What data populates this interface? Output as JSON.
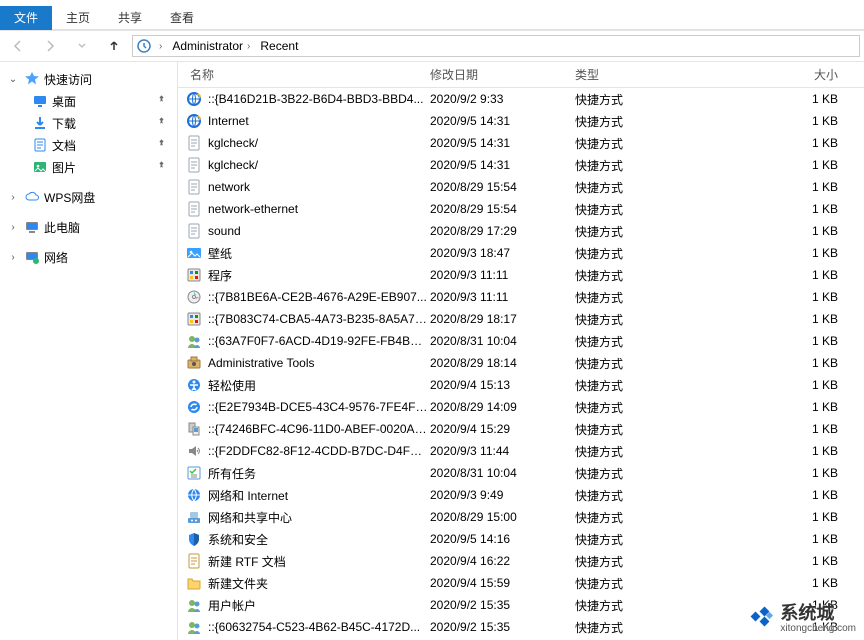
{
  "ribbon": {
    "file": "文件",
    "tabs": [
      "主页",
      "共享",
      "查看"
    ]
  },
  "address": {
    "crumbs": [
      "Administrator",
      "Recent"
    ]
  },
  "nav": {
    "quick": "快速访问",
    "quick_items": [
      {
        "label": "桌面",
        "icon": "desktop"
      },
      {
        "label": "下载",
        "icon": "download"
      },
      {
        "label": "文档",
        "icon": "document"
      },
      {
        "label": "图片",
        "icon": "picture"
      }
    ],
    "wps": "WPS网盘",
    "thispc": "此电脑",
    "network": "网络"
  },
  "columns": {
    "name": "名称",
    "date": "修改日期",
    "type": "类型",
    "size": "大小"
  },
  "files": [
    {
      "icon": "ie",
      "name": "::{B416D21B-3B22-B6D4-BBD3-BBD4...",
      "date": "2020/9/2 9:33",
      "type": "快捷方式",
      "size": "1 KB"
    },
    {
      "icon": "ie",
      "name": "Internet",
      "date": "2020/9/5 14:31",
      "type": "快捷方式",
      "size": "1 KB"
    },
    {
      "icon": "doc",
      "name": "kglcheck/",
      "date": "2020/9/5 14:31",
      "type": "快捷方式",
      "size": "1 KB"
    },
    {
      "icon": "doc",
      "name": "kglcheck/",
      "date": "2020/9/5 14:31",
      "type": "快捷方式",
      "size": "1 KB"
    },
    {
      "icon": "doc",
      "name": "network",
      "date": "2020/8/29 15:54",
      "type": "快捷方式",
      "size": "1 KB"
    },
    {
      "icon": "doc",
      "name": "network-ethernet",
      "date": "2020/8/29 15:54",
      "type": "快捷方式",
      "size": "1 KB"
    },
    {
      "icon": "doc",
      "name": "sound",
      "date": "2020/8/29 17:29",
      "type": "快捷方式",
      "size": "1 KB"
    },
    {
      "icon": "img",
      "name": "壁纸",
      "date": "2020/9/3 18:47",
      "type": "快捷方式",
      "size": "1 KB"
    },
    {
      "icon": "prog",
      "name": "程序",
      "date": "2020/9/3 11:11",
      "type": "快捷方式",
      "size": "1 KB"
    },
    {
      "icon": "disc",
      "name": "::{7B81BE6A-CE2B-4676-A29E-EB907...",
      "date": "2020/9/3 11:11",
      "type": "快捷方式",
      "size": "1 KB"
    },
    {
      "icon": "prog",
      "name": "::{7B083C74-CBA5-4A73-B235-8A5A71...",
      "date": "2020/8/29 18:17",
      "type": "快捷方式",
      "size": "1 KB"
    },
    {
      "icon": "users",
      "name": "::{63A7F0F7-6ACD-4D19-92FE-FB4BD9...",
      "date": "2020/8/31 10:04",
      "type": "快捷方式",
      "size": "1 KB"
    },
    {
      "icon": "admin",
      "name": "Administrative Tools",
      "date": "2020/8/29 18:14",
      "type": "快捷方式",
      "size": "1 KB"
    },
    {
      "icon": "ease",
      "name": "轻松使用",
      "date": "2020/9/4 15:13",
      "type": "快捷方式",
      "size": "1 KB"
    },
    {
      "icon": "sync",
      "name": "::{E2E7934B-DCE5-43C4-9576-7FE4F7...",
      "date": "2020/8/29 14:09",
      "type": "快捷方式",
      "size": "1 KB"
    },
    {
      "icon": "device",
      "name": "::{74246BFC-4C96-11D0-ABEF-0020AF...",
      "date": "2020/9/4 15:29",
      "type": "快捷方式",
      "size": "1 KB"
    },
    {
      "icon": "speaker",
      "name": "::{F2DDFC82-8F12-4CDD-B7DC-D4FE1...",
      "date": "2020/9/3 11:44",
      "type": "快捷方式",
      "size": "1 KB"
    },
    {
      "icon": "tasks",
      "name": "所有任务",
      "date": "2020/8/31 10:04",
      "type": "快捷方式",
      "size": "1 KB"
    },
    {
      "icon": "netint",
      "name": "网络和 Internet",
      "date": "2020/9/3 9:49",
      "type": "快捷方式",
      "size": "1 KB"
    },
    {
      "icon": "share",
      "name": "网络和共享中心",
      "date": "2020/8/29 15:00",
      "type": "快捷方式",
      "size": "1 KB"
    },
    {
      "icon": "security",
      "name": "系统和安全",
      "date": "2020/9/5 14:16",
      "type": "快捷方式",
      "size": "1 KB"
    },
    {
      "icon": "rtf",
      "name": "新建 RTF 文档",
      "date": "2020/9/4 16:22",
      "type": "快捷方式",
      "size": "1 KB"
    },
    {
      "icon": "folder",
      "name": "新建文件夹",
      "date": "2020/9/4 15:59",
      "type": "快捷方式",
      "size": "1 KB"
    },
    {
      "icon": "users",
      "name": "用户帐户",
      "date": "2020/9/2 15:35",
      "type": "快捷方式",
      "size": "1 KB"
    },
    {
      "icon": "users",
      "name": "::{60632754-C523-4B62-B45C-4172D...",
      "date": "2020/9/2 15:35",
      "type": "快捷方式",
      "size": "1 KB"
    }
  ],
  "watermark": {
    "title": "系统城",
    "sub": "xitongcheng.com"
  }
}
